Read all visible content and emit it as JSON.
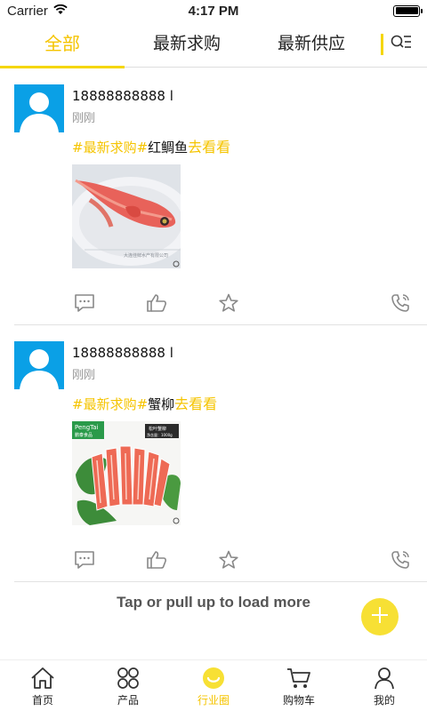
{
  "status_bar": {
    "carrier": "Carrier",
    "time": "4:17 PM"
  },
  "tabs": [
    {
      "label": "全部",
      "active": true
    },
    {
      "label": "最新求购",
      "active": false
    },
    {
      "label": "最新供应",
      "active": false
    }
  ],
  "posts": [
    {
      "user": "18888888888 l",
      "time": "刚刚",
      "tag": "#最新求购#",
      "subject": "红鲷鱼",
      "see_more": "去看看",
      "image": "red-snapper-photo",
      "image_caption": "大连佳鲜水产有限公司"
    },
    {
      "user": "18888888888 l",
      "time": "刚刚",
      "tag": "#最新求购#",
      "subject": "蟹柳",
      "see_more": "去看看",
      "image": "crab-stick-photo",
      "image_brand": "PengTai",
      "image_brand_sub": "鹏泰食品",
      "image_product": "松叶蟹柳",
      "image_weight": "净含量：1000g"
    }
  ],
  "load_more": "Tap or pull up to load more",
  "bottom_nav": [
    {
      "label": "首页",
      "icon": "home-icon",
      "active": false
    },
    {
      "label": "产品",
      "icon": "grid-icon",
      "active": false
    },
    {
      "label": "行业圈",
      "icon": "smile-icon",
      "active": true
    },
    {
      "label": "购物车",
      "icon": "cart-icon",
      "active": false
    },
    {
      "label": "我的",
      "icon": "user-icon",
      "active": false
    }
  ],
  "colors": {
    "accent": "#f5d600",
    "avatar_bg": "#0aa0e6",
    "fab": "#f7e034"
  }
}
